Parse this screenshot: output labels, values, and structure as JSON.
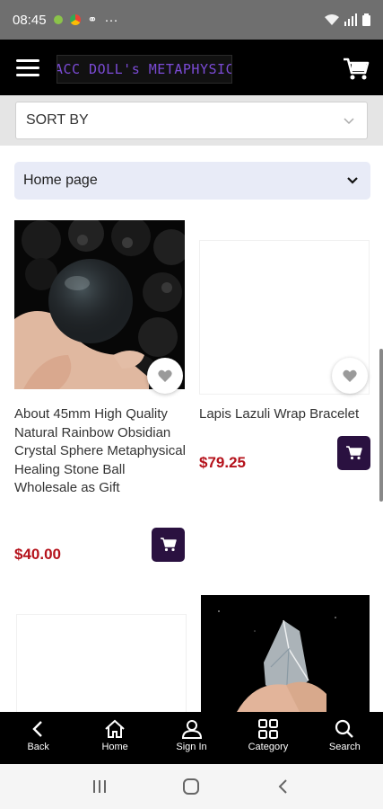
{
  "status_bar": {
    "time": "08:45",
    "more": "···"
  },
  "header": {
    "logo_text": "BLACC DOLL's METAPHYSICAL"
  },
  "sort": {
    "label": "SORT BY"
  },
  "breadcrumb": {
    "label": "Home page"
  },
  "products": [
    {
      "title": "About 45mm High Quality Natural Rainbow Obsidian Crystal Sphere Metaphysical Healing Stone Ball Wholesale as Gift",
      "price": "$40.00"
    },
    {
      "title": "Lapis Lazuli Wrap Bracelet",
      "price": "$79.25"
    }
  ],
  "bottom_nav": [
    {
      "label": "Back",
      "icon": "back-icon"
    },
    {
      "label": "Home",
      "icon": "home-icon"
    },
    {
      "label": "Sign In",
      "icon": "user-icon"
    },
    {
      "label": "Category",
      "icon": "grid-icon"
    },
    {
      "label": "Search",
      "icon": "search-icon"
    }
  ],
  "colors": {
    "accent": "#2a1140",
    "price": "#b5121b",
    "logo": "#7b4bd6"
  }
}
